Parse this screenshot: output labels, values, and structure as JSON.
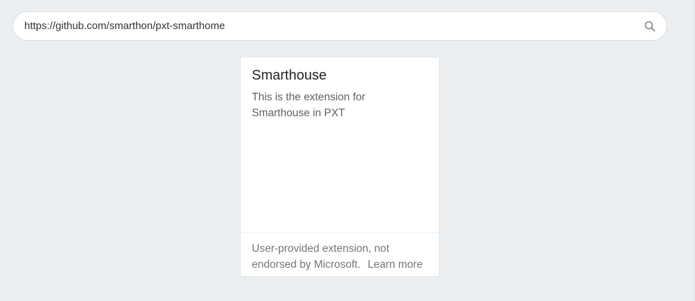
{
  "search": {
    "value": "https://github.com/smarthon/pxt-smarthome",
    "icon": "search-icon"
  },
  "card": {
    "title": "Smarthouse",
    "description": "This is the extension for Smarthouse in PXT",
    "footer_text": "User-provided extension, not endorsed by Microsoft.",
    "learn_more_label": "Learn more"
  },
  "colors": {
    "background": "#eceff1",
    "card_background": "#ffffff",
    "title_text": "#212121",
    "muted_text": "#757575"
  }
}
